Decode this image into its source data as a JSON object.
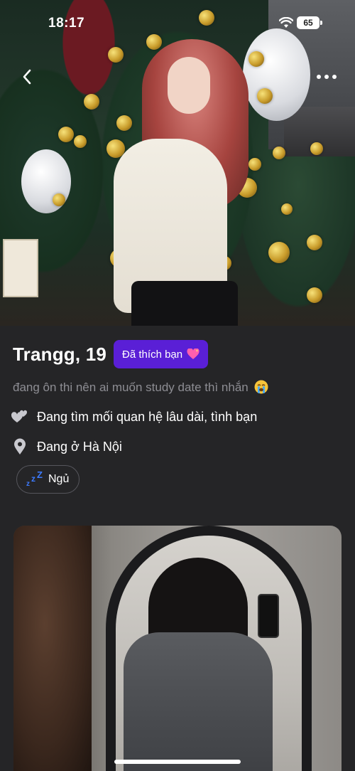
{
  "status_bar": {
    "time": "18:17",
    "battery": "65"
  },
  "top_bar": {
    "back_icon": "chevron-left-icon",
    "more_icon": "more-horizontal-icon"
  },
  "profile": {
    "name_age": "Trangg, 19",
    "liked_badge": "Đã thích bạn",
    "liked_badge_icon": "sparkling-heart-icon",
    "bio": "đang ôn thi nên ai muốn study date thì nhắn",
    "bio_emoji": "loudly-crying-face-icon",
    "looking_for": "Đang tìm mối quan hệ lâu dài, tình bạn",
    "location": "Đang ở Hà Nội",
    "tags": [
      {
        "icon": "zzz-icon",
        "label": "Ngủ"
      }
    ]
  },
  "colors": {
    "background": "#252527",
    "badge": "#5a1fd6",
    "secondary_text": "#8d8d93",
    "tag_border": "#56565c"
  }
}
